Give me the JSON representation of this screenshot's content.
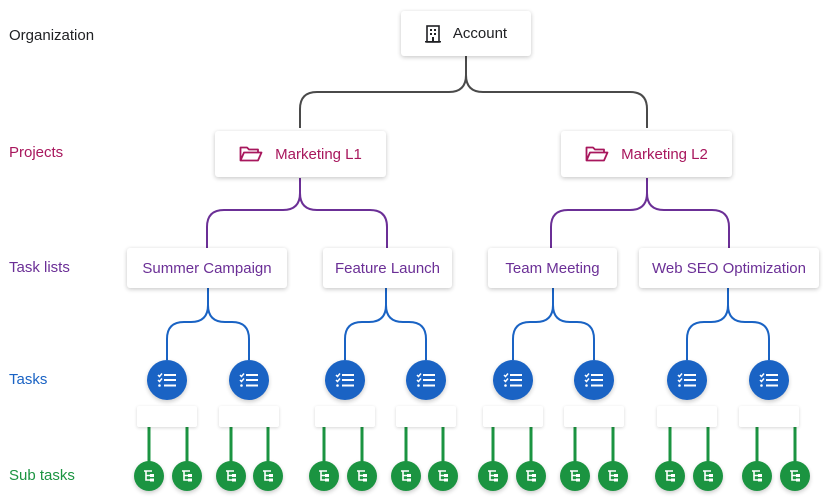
{
  "colors": {
    "organization": "#202124",
    "project": "#a8175d",
    "task_list": "#6b2f96",
    "task": "#1a63c4",
    "sub_task": "#1b9441",
    "org_line": "#4a4a4a"
  },
  "levels": {
    "organization": "Organization",
    "projects": "Projects",
    "task_lists": "Task lists",
    "tasks": "Tasks",
    "sub_tasks": "Sub tasks"
  },
  "account": {
    "label": "Account",
    "icon": "building-icon"
  },
  "projects": [
    {
      "label": "Marketing L1",
      "icon": "folder-open-icon"
    },
    {
      "label": "Marketing L2",
      "icon": "folder-open-icon"
    }
  ],
  "task_lists": [
    {
      "label": "Summer Campaign",
      "project": 0
    },
    {
      "label": "Feature Launch",
      "project": 0
    },
    {
      "label": "Team Meeting",
      "project": 1
    },
    {
      "label": "Web SEO Optimization",
      "project": 1
    }
  ],
  "tasks_per_list": 2,
  "subtasks_per_task": 2,
  "task_icon": "checklist-icon",
  "subtask_icon": "subtask-tree-icon"
}
